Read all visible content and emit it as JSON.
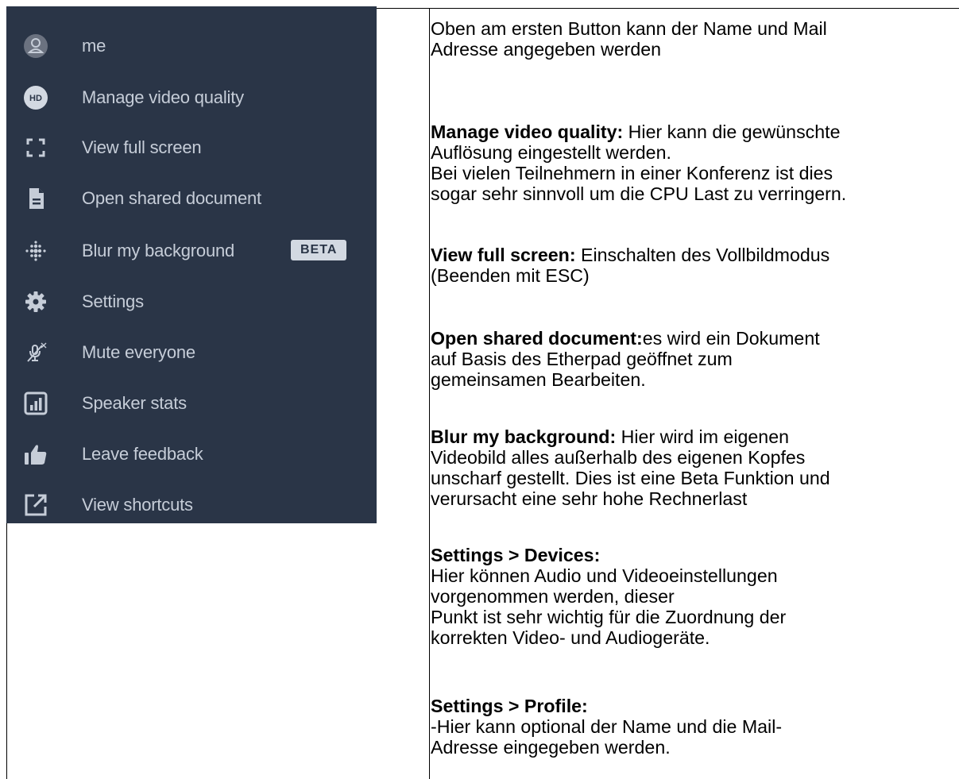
{
  "menu": {
    "items": [
      {
        "label": "me",
        "icon": "avatar-icon"
      },
      {
        "label": "Manage video quality",
        "icon": "hd-icon",
        "icon_text": "HD"
      },
      {
        "label": "View full screen",
        "icon": "fullscreen-icon"
      },
      {
        "label": "Open shared document",
        "icon": "document-icon"
      },
      {
        "label": "Blur my background",
        "icon": "blur-icon",
        "badge": "BETA"
      },
      {
        "label": "Settings",
        "icon": "gear-icon"
      },
      {
        "label": "Mute everyone",
        "icon": "mic-mute-icon"
      },
      {
        "label": "Speaker stats",
        "icon": "stats-icon"
      },
      {
        "label": "Leave feedback",
        "icon": "thumbs-up-icon"
      },
      {
        "label": "View shortcuts",
        "icon": "external-link-icon"
      }
    ],
    "colors": {
      "background": "#2a3547",
      "text": "#c6cdd8",
      "icon": "#c6cdd8",
      "badge_bg": "#d3d9e2"
    }
  },
  "descriptions": {
    "intro": [
      "Oben am ersten Button kann der Name und Mail",
      "Adresse angegeben werden"
    ],
    "video_quality": {
      "title": "Manage video quality:",
      "line1_rest": " Hier kann die gewünschte",
      "lines": [
        "Auflösung eingestellt werden.",
        "Bei vielen Teilnehmern in einer Konferenz  ist dies",
        "sogar sehr sinnvoll um die CPU Last zu verringern."
      ]
    },
    "full_screen": {
      "title": "View full screen:",
      "line1_rest": "  Einschalten des Vollbildmodus",
      "lines": [
        "(Beenden mit ESC)"
      ]
    },
    "shared_document": {
      "title": "Open shared document:",
      "line1_rest": "es wird ein Dokument",
      "lines": [
        "auf Basis des Etherpad geöffnet zum",
        "gemeinsamen Bearbeiten."
      ]
    },
    "blur": {
      "title": "Blur my background:",
      "line1_rest": " Hier wird im eigenen",
      "lines": [
        "Videobild alles außerhalb des eigenen Kopfes",
        "unscharf gestellt. Dies ist eine Beta Funktion und",
        "verursacht eine sehr hohe Rechnerlast"
      ]
    },
    "devices": {
      "title": "Settings > Devices:",
      "lines": [
        "Hier können Audio und Videoeinstellungen",
        "vorgenommen werden, dieser",
        "Punkt ist sehr wichtig für die Zuordnung der",
        "korrekten Video- und Audiogeräte."
      ]
    },
    "profile": {
      "title": "Settings > Profile:",
      "lines": [
        "-Hier kann optional der Name und die Mail-",
        "Adresse eingegeben werden."
      ]
    }
  }
}
